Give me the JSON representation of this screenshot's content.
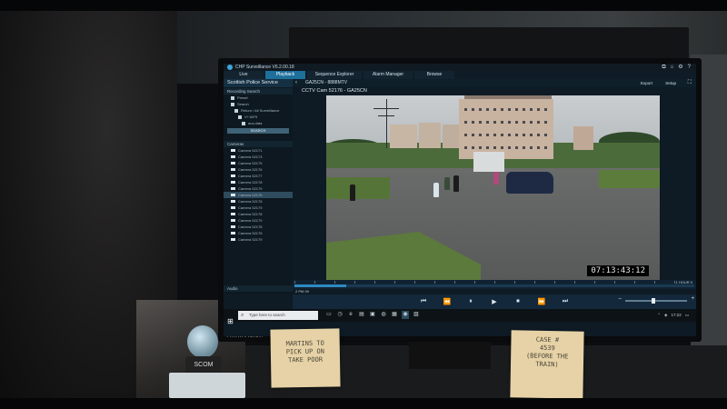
{
  "app": {
    "title": "CHP Surveillance",
    "version": "V6.2.00.18",
    "window_icons": [
      "⧉",
      "⌂",
      "⚙",
      "?"
    ]
  },
  "tabs": [
    {
      "label": "Live",
      "active": false
    },
    {
      "label": "Playback",
      "active": true
    },
    {
      "label": "Sequence Explorer",
      "active": false
    },
    {
      "label": "Alarm Manager",
      "active": false
    },
    {
      "label": "Browse",
      "active": false
    }
  ],
  "sidebar": {
    "header": "Scottish Police Service",
    "recording_search": {
      "label": "Recording Search",
      "tree": [
        "Preset",
        "Search",
        "Return / All Surveillance",
        "V+16F9",
        "aus.data"
      ],
      "search_button": "SEARCH"
    },
    "cameras": {
      "label": "Cameras",
      "items": [
        "Camera 52171",
        "Camera 52173",
        "Camera 52175",
        "Camera 52176",
        "Camera 52177",
        "Camera 52178",
        "Camera 52179",
        "Camera 52176",
        "Camera 52178",
        "Camera 52179",
        "Camera 52178",
        "Camera 52179",
        "Camera 52178",
        "Camera 52178",
        "Camera 52179"
      ],
      "selected_index": 7
    },
    "audio_label": "Audio"
  },
  "main": {
    "header_camera": "GA25CN - 8888MTV",
    "export_label": "Export",
    "setup_label": "Setup",
    "video_label": "CCTV Cam 52176 - GA25CN",
    "timestamp": "07:13:43:12"
  },
  "timeline": {
    "left_label": "2 PM 09",
    "right_label": "1 HOUR 0",
    "progress": 0.13
  },
  "controls": {
    "buttons": [
      "⏮",
      "⏪",
      "⏸",
      "▶",
      "⏹",
      "⏩",
      "⏭"
    ],
    "speed_level": 0.45,
    "speed_minus": "–",
    "speed_plus": "+"
  },
  "taskbar": {
    "search_placeholder": "Type here to search",
    "search_icon": "⌕",
    "icons": [
      "▭",
      "◷",
      "e",
      "▤",
      "▣",
      "◍",
      "▦",
      "◉",
      "▧"
    ],
    "active_icon_index": 7,
    "tray": [
      "⌃",
      "◈",
      "17:22",
      "▭"
    ]
  },
  "monitor_brand": "ThinkVision",
  "notes": {
    "note1": [
      "MARTINS TO",
      "PICK UP ON",
      "TAKE POOR"
    ],
    "note2": [
      "CASE #",
      "4539",
      "(BEFORE THE",
      "TRAIN)"
    ]
  },
  "desk_items": {
    "snowglobe_label": "SCOM"
  },
  "colors": {
    "accent": "#1d6f9c",
    "screen_bg": "#0e1a24",
    "sticky_note": "#e6d2a6"
  }
}
